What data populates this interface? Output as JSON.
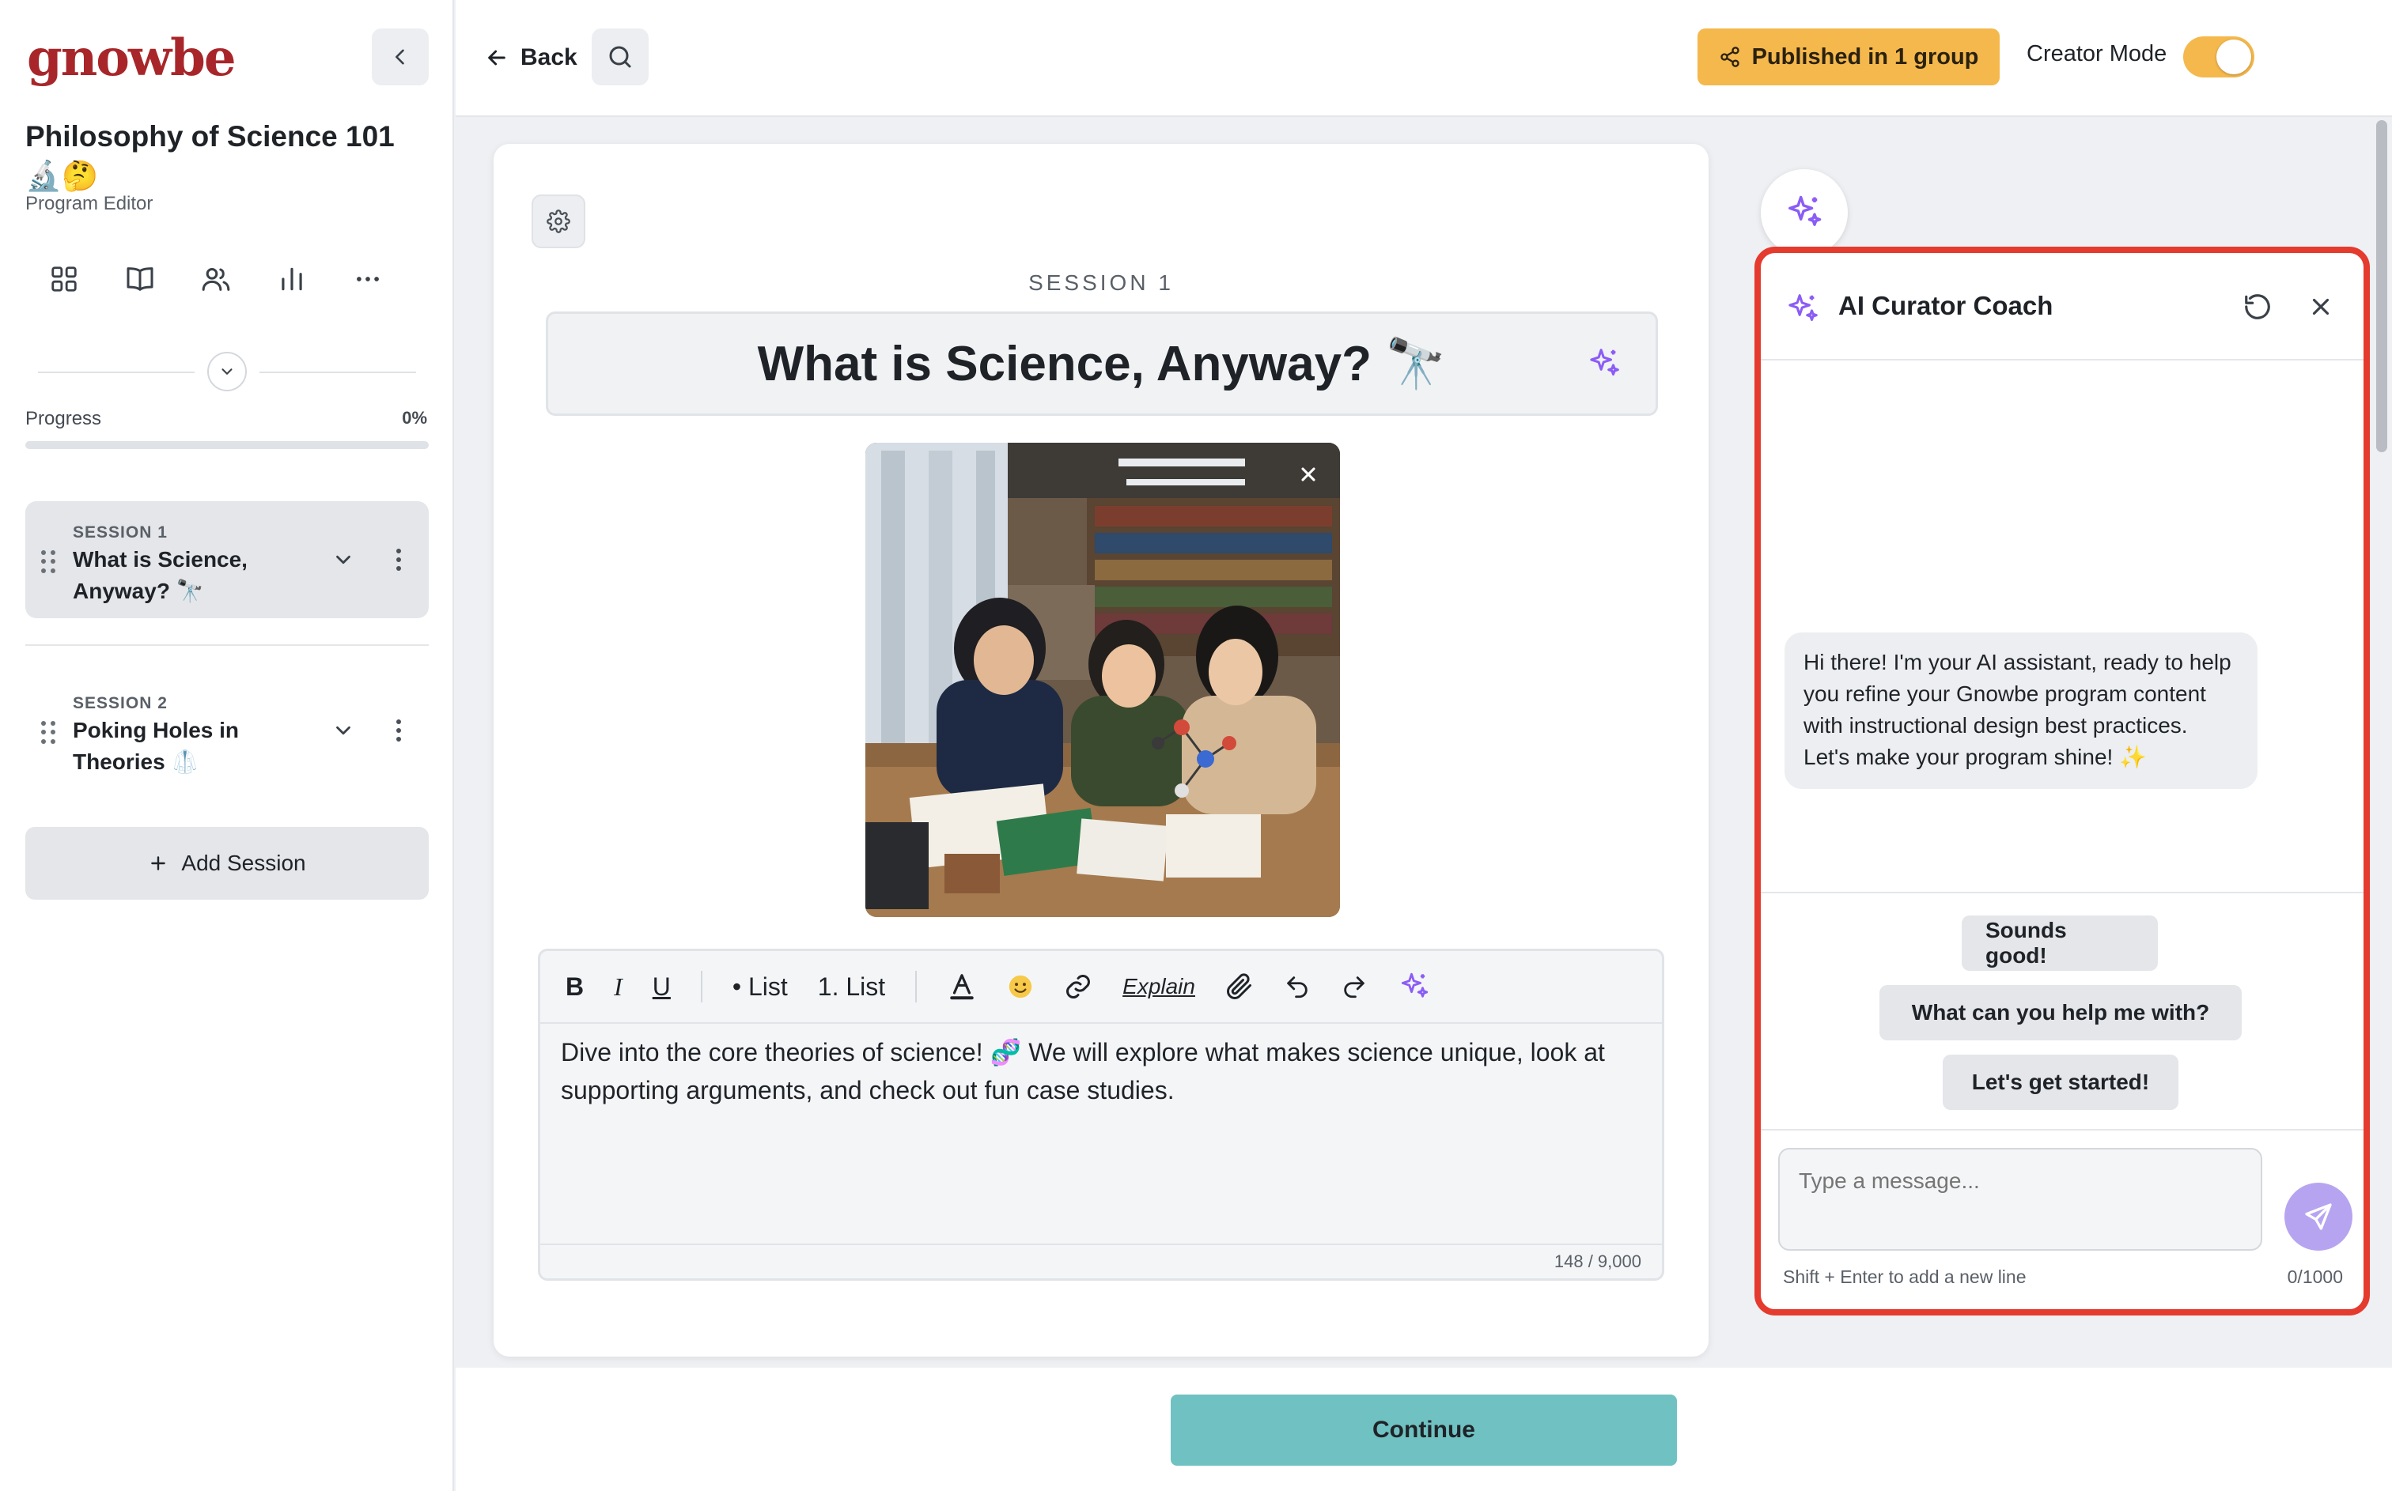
{
  "app": {
    "logo_text": "gnowbe",
    "brand_color": "#a8262a",
    "accent_color": "#f5b84c",
    "ai_color": "#8b5cf6",
    "highlight_border": "#e53a2e"
  },
  "sidebar": {
    "program_title": "Philosophy of Science 101 🔬🤔",
    "program_subtitle": "Program Editor",
    "nav_icons": [
      "grid-icon",
      "book-icon",
      "users-icon",
      "chart-icon",
      "more-icon"
    ],
    "progress": {
      "label": "Progress",
      "value_text": "0%",
      "value": 0
    },
    "sessions": [
      {
        "kicker": "SESSION 1",
        "name": "What is Science, Anyway? 🔭",
        "active": true
      },
      {
        "kicker": "SESSION 2",
        "name": "Poking Holes in Theories 🥼",
        "active": false
      }
    ],
    "add_session_label": "Add Session"
  },
  "topbar": {
    "back_label": "Back",
    "published_label": "Published in 1 group",
    "creator_mode_label": "Creator Mode",
    "creator_mode_on": true
  },
  "editor": {
    "session_label": "SESSION 1",
    "title": "What is Science, Anyway? 🔭",
    "toolbar": {
      "bold": "B",
      "italic": "I",
      "underline": "U",
      "bullet_list": "• List",
      "numbered_list": "1. List",
      "explain": "Explain"
    },
    "body_text": "Dive into the core theories of science! 🧬 We will explore what makes science unique, look at supporting arguments, and check out fun case studies.",
    "char_count": "148 / 9,000"
  },
  "footer": {
    "continue_label": "Continue"
  },
  "coach": {
    "title": "AI Curator Coach",
    "greeting": "Hi there! I'm your AI assistant, ready to help you refine your Gnowbe program content with instructional design best practices. Let's make your program shine! ✨",
    "suggestions": [
      "Sounds good!",
      "What can you help me with?",
      "Let's get started!"
    ],
    "input_placeholder": "Type a message...",
    "hint": "Shift + Enter to add a new line",
    "count": "0/1000"
  }
}
